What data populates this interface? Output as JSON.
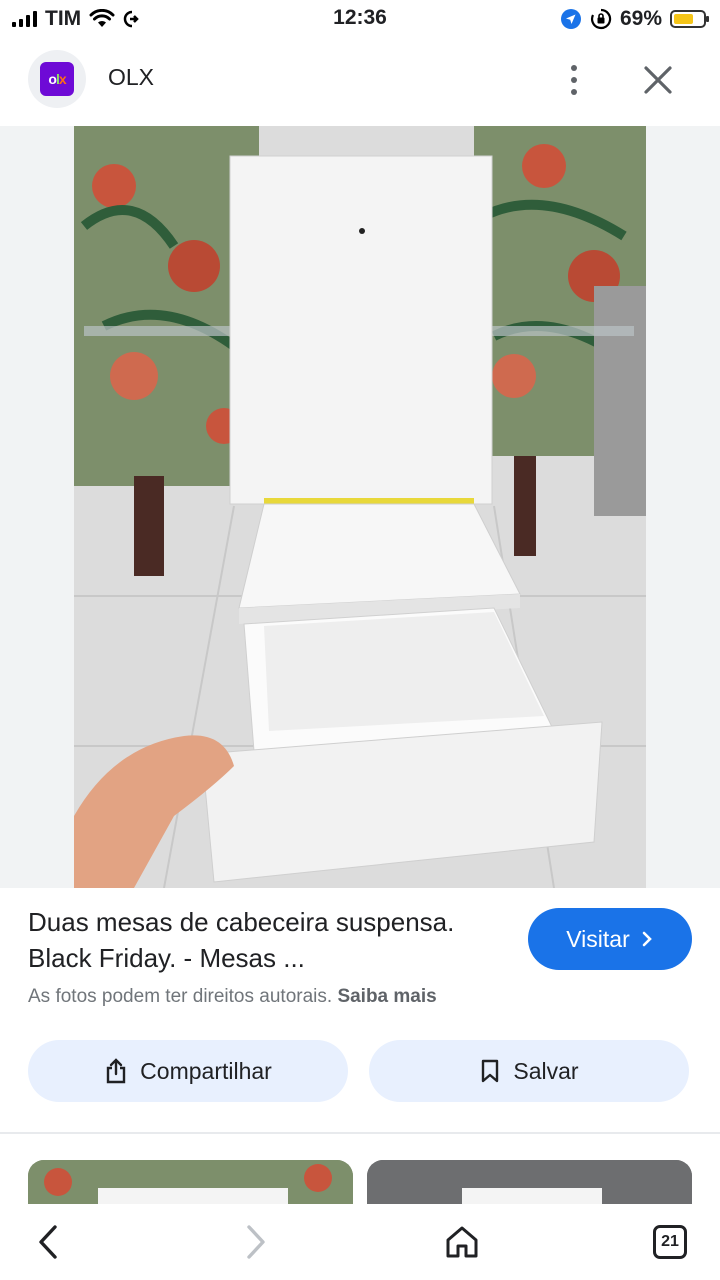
{
  "status_bar": {
    "carrier": "TIM",
    "time": "12:36",
    "battery_percent": "69%",
    "battery_level": 0.69,
    "battery_color": "#f5c518"
  },
  "header": {
    "site_name": "OLX",
    "logo_icon": "olx-logo"
  },
  "result": {
    "title": "Duas mesas de cabeceira suspensa. Black Friday. - Mesas ...",
    "visit_label": "Visitar",
    "copyright_note": "As fotos podem ter direitos autorais.",
    "learn_more_label": "Saiba mais"
  },
  "actions": {
    "share_label": "Compartilhar",
    "save_label": "Salvar"
  },
  "bottom_nav": {
    "tabs_count": "21"
  },
  "colors": {
    "accent": "#1a73e8",
    "action_bg": "#e8f0fe",
    "olx_purple": "#6e0ad6"
  }
}
